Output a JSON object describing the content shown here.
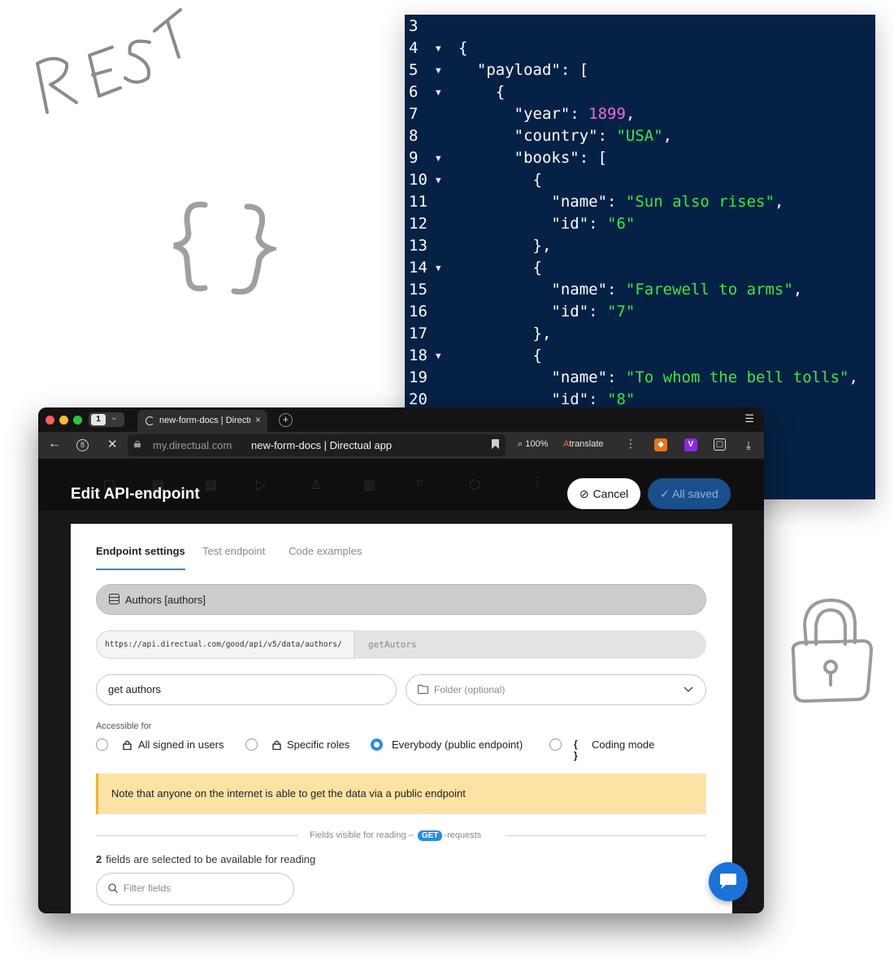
{
  "code": {
    "lines": [
      {
        "n": "3",
        "fold": false,
        "parts": []
      },
      {
        "n": "4",
        "fold": true,
        "parts": [
          {
            "t": "{",
            "c": "p"
          }
        ]
      },
      {
        "n": "5",
        "fold": true,
        "parts": [
          {
            "t": "  \"payload\": [",
            "c": "p"
          }
        ]
      },
      {
        "n": "6",
        "fold": true,
        "parts": [
          {
            "t": "    {",
            "c": "p"
          }
        ]
      },
      {
        "n": "7",
        "fold": false,
        "parts": [
          {
            "t": "      \"year\": ",
            "c": "p"
          },
          {
            "t": "1899",
            "c": "num"
          },
          {
            "t": ",",
            "c": "p"
          }
        ]
      },
      {
        "n": "8",
        "fold": false,
        "parts": [
          {
            "t": "      \"country\": ",
            "c": "p"
          },
          {
            "t": "\"USA\"",
            "c": "str"
          },
          {
            "t": ",",
            "c": "p"
          }
        ]
      },
      {
        "n": "9",
        "fold": true,
        "parts": [
          {
            "t": "      \"books\": [",
            "c": "p"
          }
        ]
      },
      {
        "n": "10",
        "fold": true,
        "parts": [
          {
            "t": "        {",
            "c": "p"
          }
        ]
      },
      {
        "n": "11",
        "fold": false,
        "parts": [
          {
            "t": "          \"name\": ",
            "c": "p"
          },
          {
            "t": "\"Sun also rises\"",
            "c": "str"
          },
          {
            "t": ",",
            "c": "p"
          }
        ]
      },
      {
        "n": "12",
        "fold": false,
        "parts": [
          {
            "t": "          \"id\": ",
            "c": "p"
          },
          {
            "t": "\"6\"",
            "c": "str"
          }
        ]
      },
      {
        "n": "13",
        "fold": false,
        "parts": [
          {
            "t": "        },",
            "c": "p"
          }
        ]
      },
      {
        "n": "14",
        "fold": true,
        "parts": [
          {
            "t": "        {",
            "c": "p"
          }
        ]
      },
      {
        "n": "15",
        "fold": false,
        "parts": [
          {
            "t": "          \"name\": ",
            "c": "p"
          },
          {
            "t": "\"Farewell to arms\"",
            "c": "str"
          },
          {
            "t": ",",
            "c": "p"
          }
        ]
      },
      {
        "n": "16",
        "fold": false,
        "parts": [
          {
            "t": "          \"id\": ",
            "c": "p"
          },
          {
            "t": "\"7\"",
            "c": "str"
          }
        ]
      },
      {
        "n": "17",
        "fold": false,
        "parts": [
          {
            "t": "        },",
            "c": "p"
          }
        ]
      },
      {
        "n": "18",
        "fold": true,
        "parts": [
          {
            "t": "        {",
            "c": "p"
          }
        ]
      },
      {
        "n": "19",
        "fold": false,
        "parts": [
          {
            "t": "          \"name\": ",
            "c": "p"
          },
          {
            "t": "\"To whom the bell tolls\"",
            "c": "str"
          },
          {
            "t": ",",
            "c": "p"
          }
        ]
      },
      {
        "n": "20",
        "fold": false,
        "parts": [
          {
            "t": "          \"id\": ",
            "c": "p"
          },
          {
            "t": "\"8\"",
            "c": "str"
          }
        ]
      }
    ]
  },
  "sketch": {
    "rest_text": "REST"
  },
  "browser": {
    "workspace_number": "1",
    "tab_title": "new-form-docs | Directual app",
    "address_domain": "my.directual.com",
    "address_title": "new-form-docs | Directual app",
    "zoom": "100%",
    "translate": "translate",
    "extension_v": "V"
  },
  "header": {
    "title": "Edit API-endpoint",
    "cancel_label": "Cancel",
    "saved_label": "All saved"
  },
  "tabs": {
    "settings": "Endpoint settings",
    "test": "Test endpoint",
    "examples": "Code examples"
  },
  "form": {
    "collection": "Authors [authors]",
    "url_prefix": "https://api.directual.com/good/api/v5/data/authors/",
    "url_slug": "getAutors",
    "name_value": "get authors",
    "folder_placeholder": "Folder (optional)",
    "accessible_label": "Accessible for",
    "access_options": {
      "signed": "All signed in users",
      "roles": "Specific roles",
      "everybody": "Everybody (public endpoint)",
      "coding": "Coding mode"
    },
    "selected_access": "everybody",
    "notice": "Note that anyone on the internet is able to get the data via a public endpoint",
    "fields_prefix": "Fields visible for reading –",
    "fields_method": "GET",
    "fields_suffix": "-requests",
    "fields_count": "2",
    "fields_count_text": "fields are selected to be available for reading",
    "filter_placeholder": "Filter fields"
  },
  "colors": {
    "code_bg": "#062146",
    "code_string": "#3ee63e",
    "code_number": "#e86cdc",
    "accent": "#2a8ae6",
    "notice_bg": "#fce3a4"
  }
}
